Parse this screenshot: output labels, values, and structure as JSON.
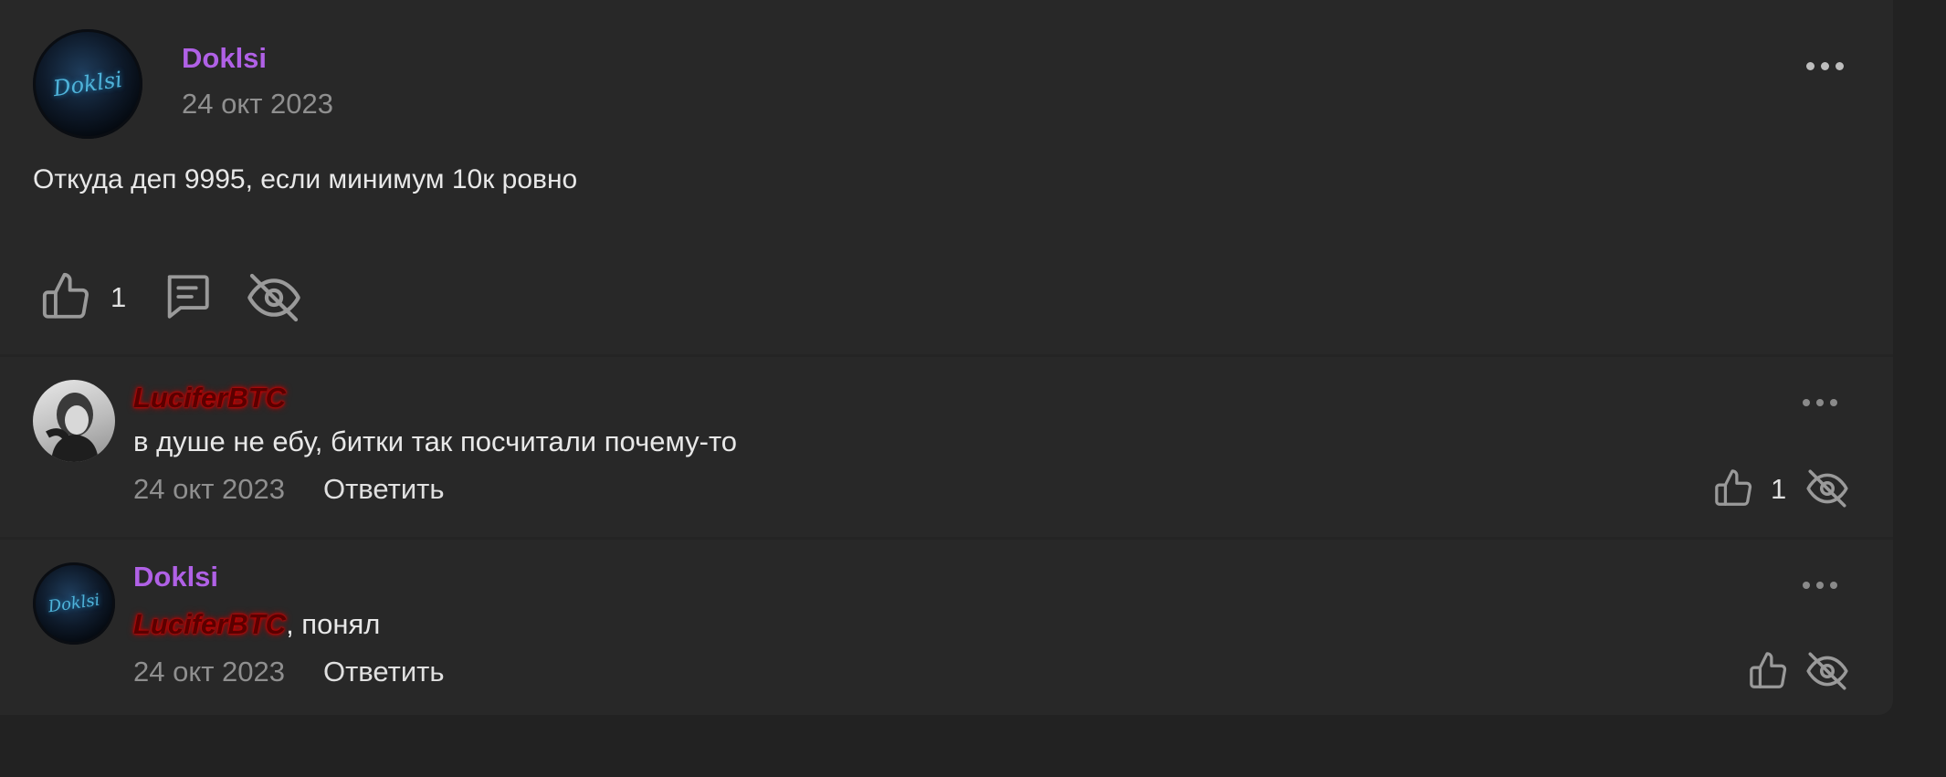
{
  "post": {
    "author": "Doklsi",
    "avatar_text": "Doklsi",
    "date": "24 окт 2023",
    "text": "Откуда деп 9995, если минимум 10к ровно",
    "likes": "1"
  },
  "comments": [
    {
      "author": "LuciferBTC",
      "text": "в душе не ебу, битки так посчитали почему-то",
      "date": "24 окт 2023",
      "reply_label": "Ответить",
      "likes": "1"
    },
    {
      "author": "Doklsi",
      "avatar_text": "Doklsi",
      "mention": "LuciferBTC",
      "text": ", понял",
      "date": "24 окт 2023",
      "reply_label": "Ответить"
    }
  ],
  "colors": {
    "background": "#222222",
    "card": "#282828",
    "author_accent": "#b061e6",
    "lucifer_name": "#d00000",
    "muted": "#8f8f8f"
  },
  "icons": [
    "more-icon",
    "like-icon",
    "comment-icon",
    "hide-eye-icon"
  ]
}
